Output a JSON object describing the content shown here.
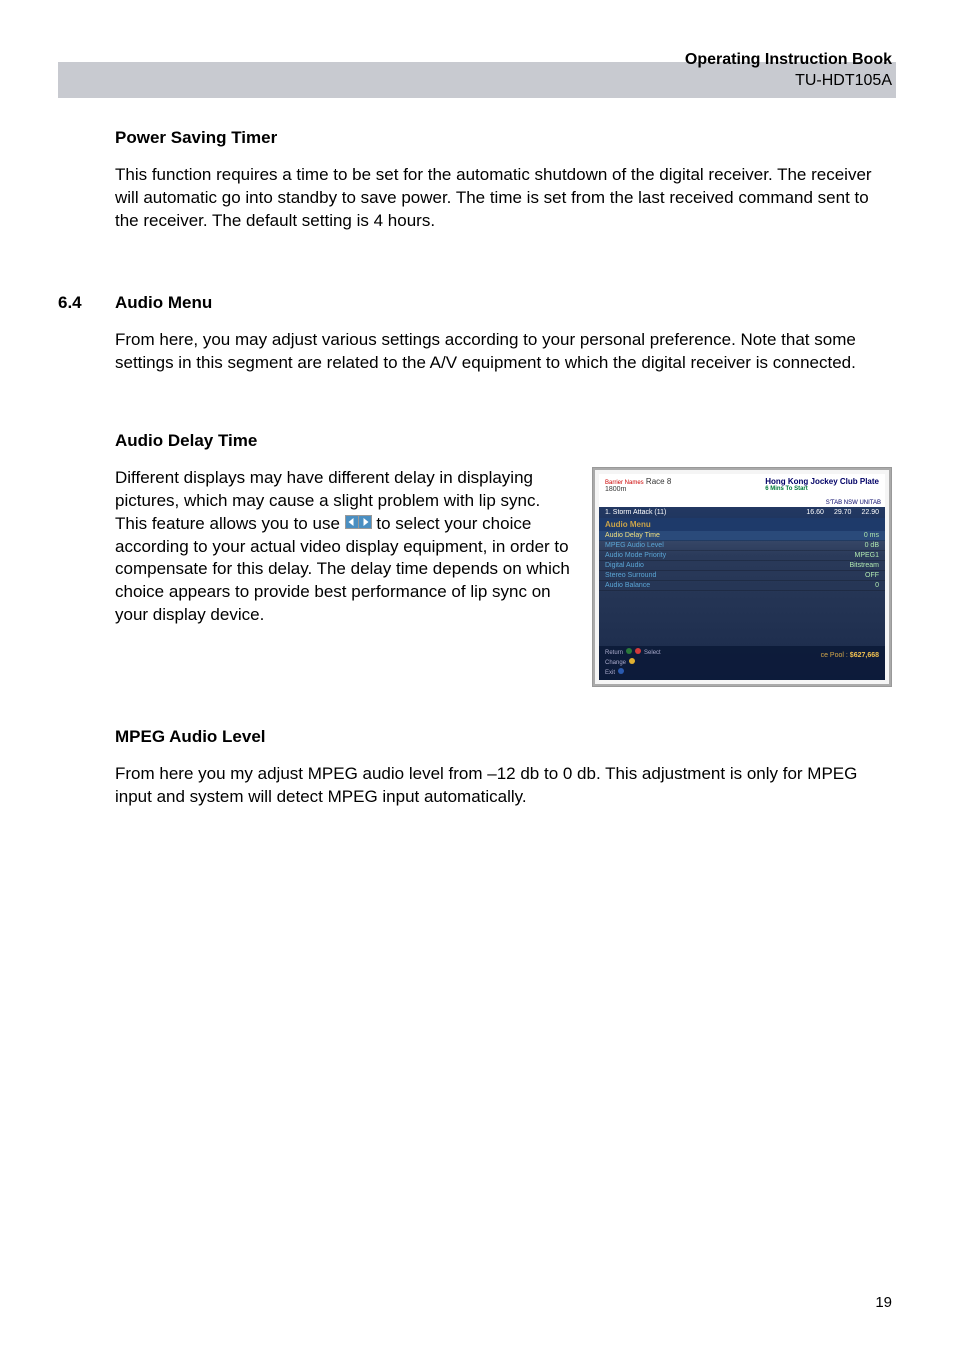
{
  "header": {
    "title": "Operating Instruction Book",
    "model": "TU-HDT105A"
  },
  "power_saving": {
    "heading": "Power Saving Timer",
    "body": "This function requires a time to be set for the automatic shutdown of the digital receiver. The receiver will automatic go into standby to save power. The time is set from the last received command sent to the receiver.  The default setting is 4 hours."
  },
  "section_6_4": {
    "number": "6.4",
    "heading": "Audio Menu",
    "intro": "From here, you may adjust various settings according to your personal preference. Note that some settings in this segment are related to the A/V equipment to which the digital receiver is connected."
  },
  "audio_delay": {
    "heading": "Audio Delay Time",
    "body_before": "Different displays may have different delay in displaying pictures, which may cause a slight problem with lip sync. This feature allows you to use ",
    "body_after": " to select your choice according to your actual video display equipment, in order to compensate for this delay.  The delay time depends on which choice appears to provide best performance of lip sync on your display device."
  },
  "mpeg": {
    "heading": "MPEG Audio Level",
    "body": "From here you my adjust MPEG audio level from –12 db to 0 db.  This adjustment is only for MPEG input and system will detect MPEG input automatically."
  },
  "tv": {
    "barrier": "Barrier Names",
    "race": "Race 8",
    "title": "Hong Kong Jockey Club Plate",
    "distance": "1800m",
    "mins": "6 Mins To Start",
    "tabs": "S'TAB   NSW   UNITAB",
    "banner_text": "1. Storm Attack (11)",
    "banner_prices": [
      "16.60",
      "29.70",
      "22.90"
    ],
    "menu_title": "Audio Menu",
    "rows": [
      {
        "label": "Audio Delay Time",
        "value": "0 ms"
      },
      {
        "label": "MPEG Audio Level",
        "value": "0 dB"
      },
      {
        "label": "Audio Mode Priority",
        "value": "MPEG1"
      },
      {
        "label": "Digital Audio",
        "value": "Bitstream"
      },
      {
        "label": "Stereo Surround",
        "value": "OFF"
      },
      {
        "label": "Audio Balance",
        "value": "0"
      }
    ],
    "nav_return": "Return",
    "nav_select": "Select",
    "nav_change": "Change",
    "nav_exit": "Exit",
    "pool_label": "ce Pool :",
    "pool_value": "$627,668"
  },
  "page_number": "19"
}
